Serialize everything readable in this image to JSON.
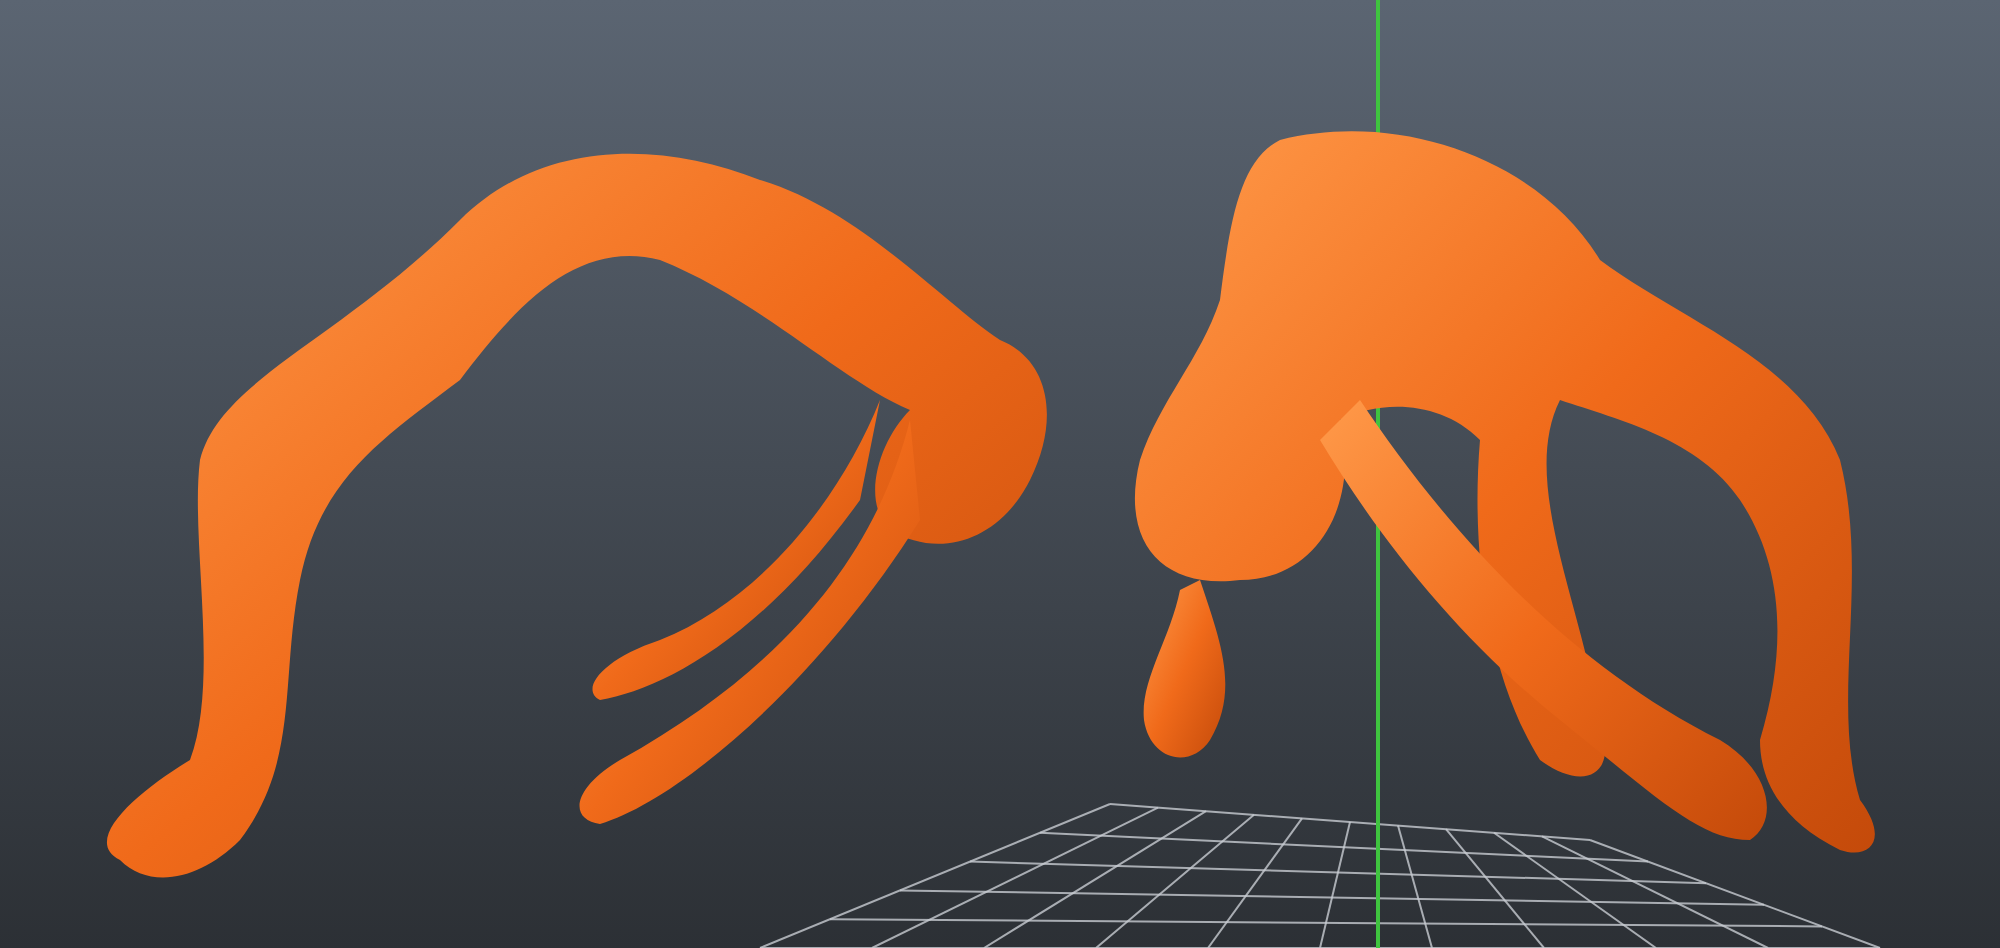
{
  "viewport": {
    "grid_visible": true,
    "axis_visible": true
  }
}
